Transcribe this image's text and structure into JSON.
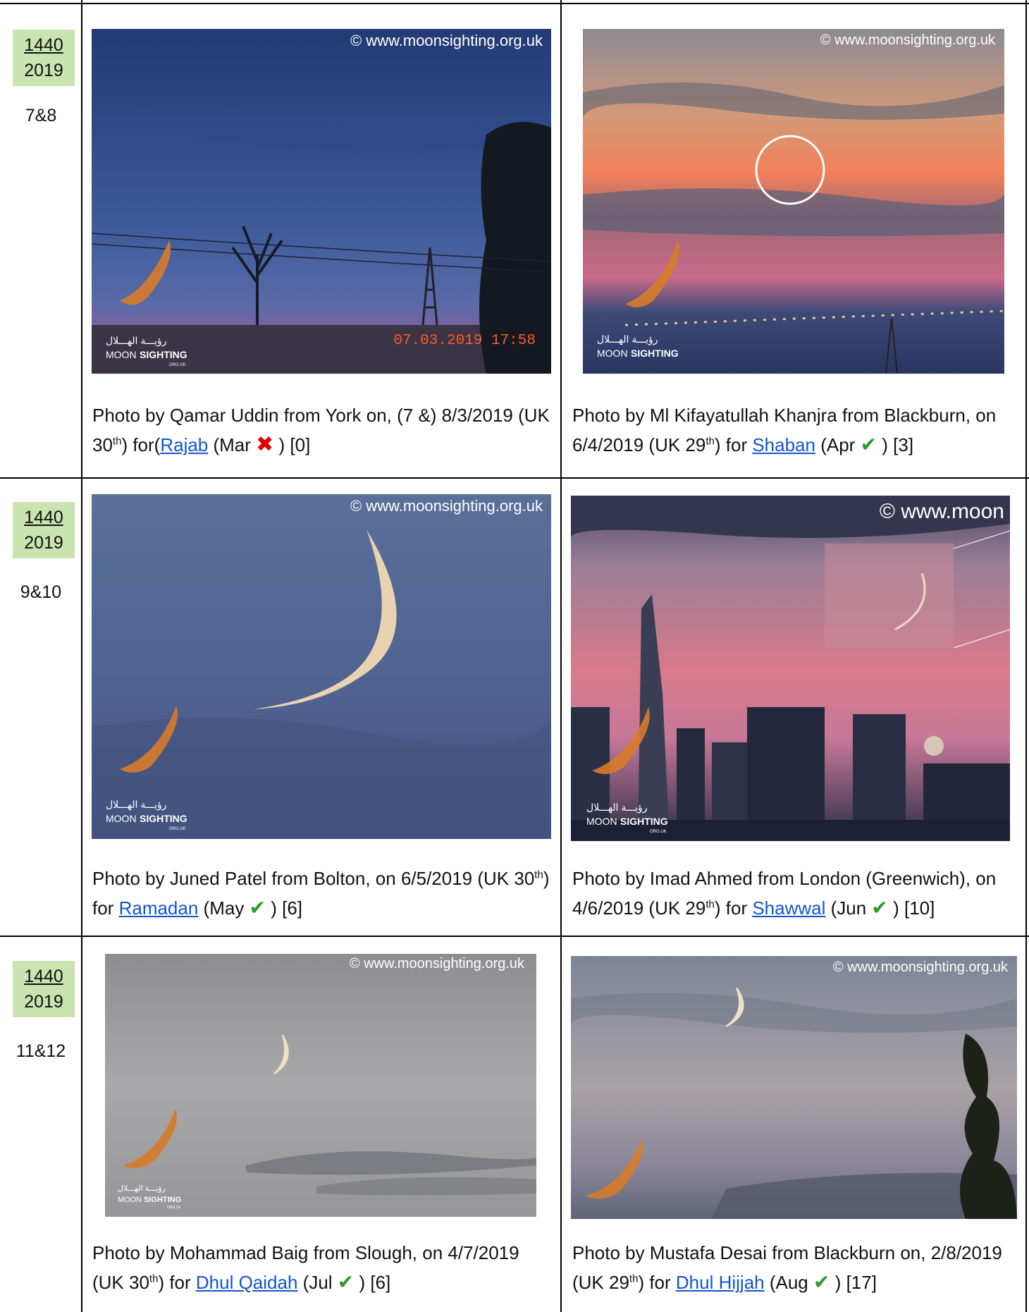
{
  "rows": [
    {
      "year_hijri": "1440",
      "year_greg": "2019",
      "months": "7&8",
      "cells": [
        {
          "watermark": "© www.moonsighting.org.uk",
          "stamp": "07.03.2019 17:58",
          "logo_ar": "رؤيـــة الهـــلال",
          "logo_moon": "MOON",
          "logo_sighting": "SIGHTING",
          "logo_org": "ORG.UK",
          "cap_a": "Photo by Qamar Uddin from York on, (7 &) 8/3/2019 (UK 30",
          "sup": "th",
          "cap_b": ") for(",
          "month_link": "Rajab",
          "cap_c": " (Mar ",
          "mark": "✖",
          "cap_d": " ) [0]"
        },
        {
          "watermark": "© www.moonsighting.org.uk",
          "logo_ar": "رؤيـــة الهـــلال",
          "logo_moon": "MOON",
          "logo_sighting": "SIGHTING",
          "cap_a": "Photo by Ml Kifayatullah Khanjra from Blackburn, on 6/4/2019 (UK 29",
          "sup": "th",
          "cap_b": ") for ",
          "month_link": "Shaban",
          "cap_c": " (Apr ",
          "mark": "✔",
          "cap_d": " ) [3]"
        }
      ]
    },
    {
      "year_hijri": "1440",
      "year_greg": "2019",
      "months": "9&10",
      "cells": [
        {
          "watermark": "© www.moonsighting.org.uk",
          "logo_ar": "رؤيـــة الهـــلال",
          "logo_moon": "MOON",
          "logo_sighting": "SIGHTING",
          "logo_org": "ORG.UK",
          "cap_a": "Photo by Juned Patel from Bolton, on 6/5/2019 (UK 30",
          "sup": "th",
          "cap_b": ") for ",
          "month_link": "Ramadan",
          "cap_c": " (May ",
          "mark": "✔",
          "cap_d": " ) [6]"
        },
        {
          "watermark": "© www.moon",
          "logo_ar": "رؤيـــة الهـــلال",
          "logo_moon": "MOON",
          "logo_sighting": "SIGHTING",
          "logo_org": "ORG.UK",
          "cap_a": "Photo by Imad Ahmed from London (Greenwich), on 4/6/2019 (UK 29",
          "sup": "th",
          "cap_b": ") for ",
          "month_link": "Shawwal",
          "cap_c": " (Jun ",
          "mark": "✔",
          "cap_d": " ) [10]"
        }
      ]
    },
    {
      "year_hijri": "1440",
      "year_greg": "2019",
      "months": "11&12",
      "cells": [
        {
          "watermark": "© www.moonsighting.org.uk",
          "logo_ar": "رؤيـــة الهـــلال",
          "logo_moon": "MOON",
          "logo_sighting": "SIGHTING",
          "logo_org": "ORG.UK",
          "cap_a": "Photo by Mohammad Baig from Slough, on 4/7/2019 (UK 30",
          "sup": "th",
          "cap_b": ") for ",
          "month_link": "Dhul Qaidah",
          "cap_c": " (Jul ",
          "mark": "✔",
          "cap_d": " ) [6]"
        },
        {
          "watermark": "© www.moonsighting.org.uk",
          "cap_a": "Photo by  Mustafa Desai from Blackburn on, 2/8/2019 (UK 29",
          "sup": "th",
          "cap_b": ") for ",
          "month_link": "Dhul Hijjah",
          "cap_c": " (Aug ",
          "mark": "✔",
          "cap_d": " ) [17]"
        }
      ]
    }
  ]
}
